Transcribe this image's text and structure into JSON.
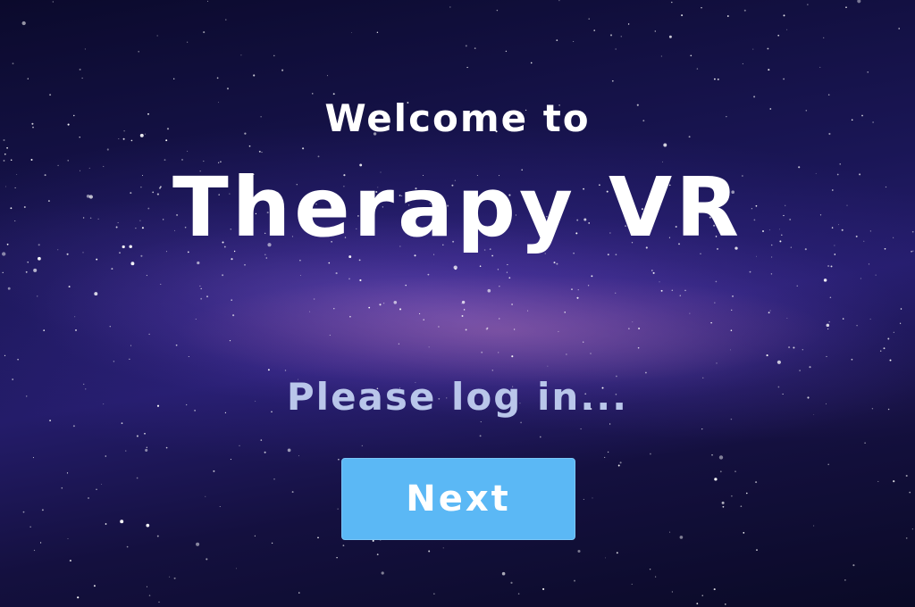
{
  "welcome": {
    "line1": "Welcome to",
    "app_name": "Therapy VR"
  },
  "login": {
    "prompt": "Please log in..."
  },
  "actions": {
    "next_label": "Next"
  },
  "colors": {
    "button_bg": "#5bb8f5",
    "prompt_text": "#b9c6ea",
    "title_text": "#ffffff"
  },
  "background": {
    "description_icon": "starfield-milky-way"
  }
}
